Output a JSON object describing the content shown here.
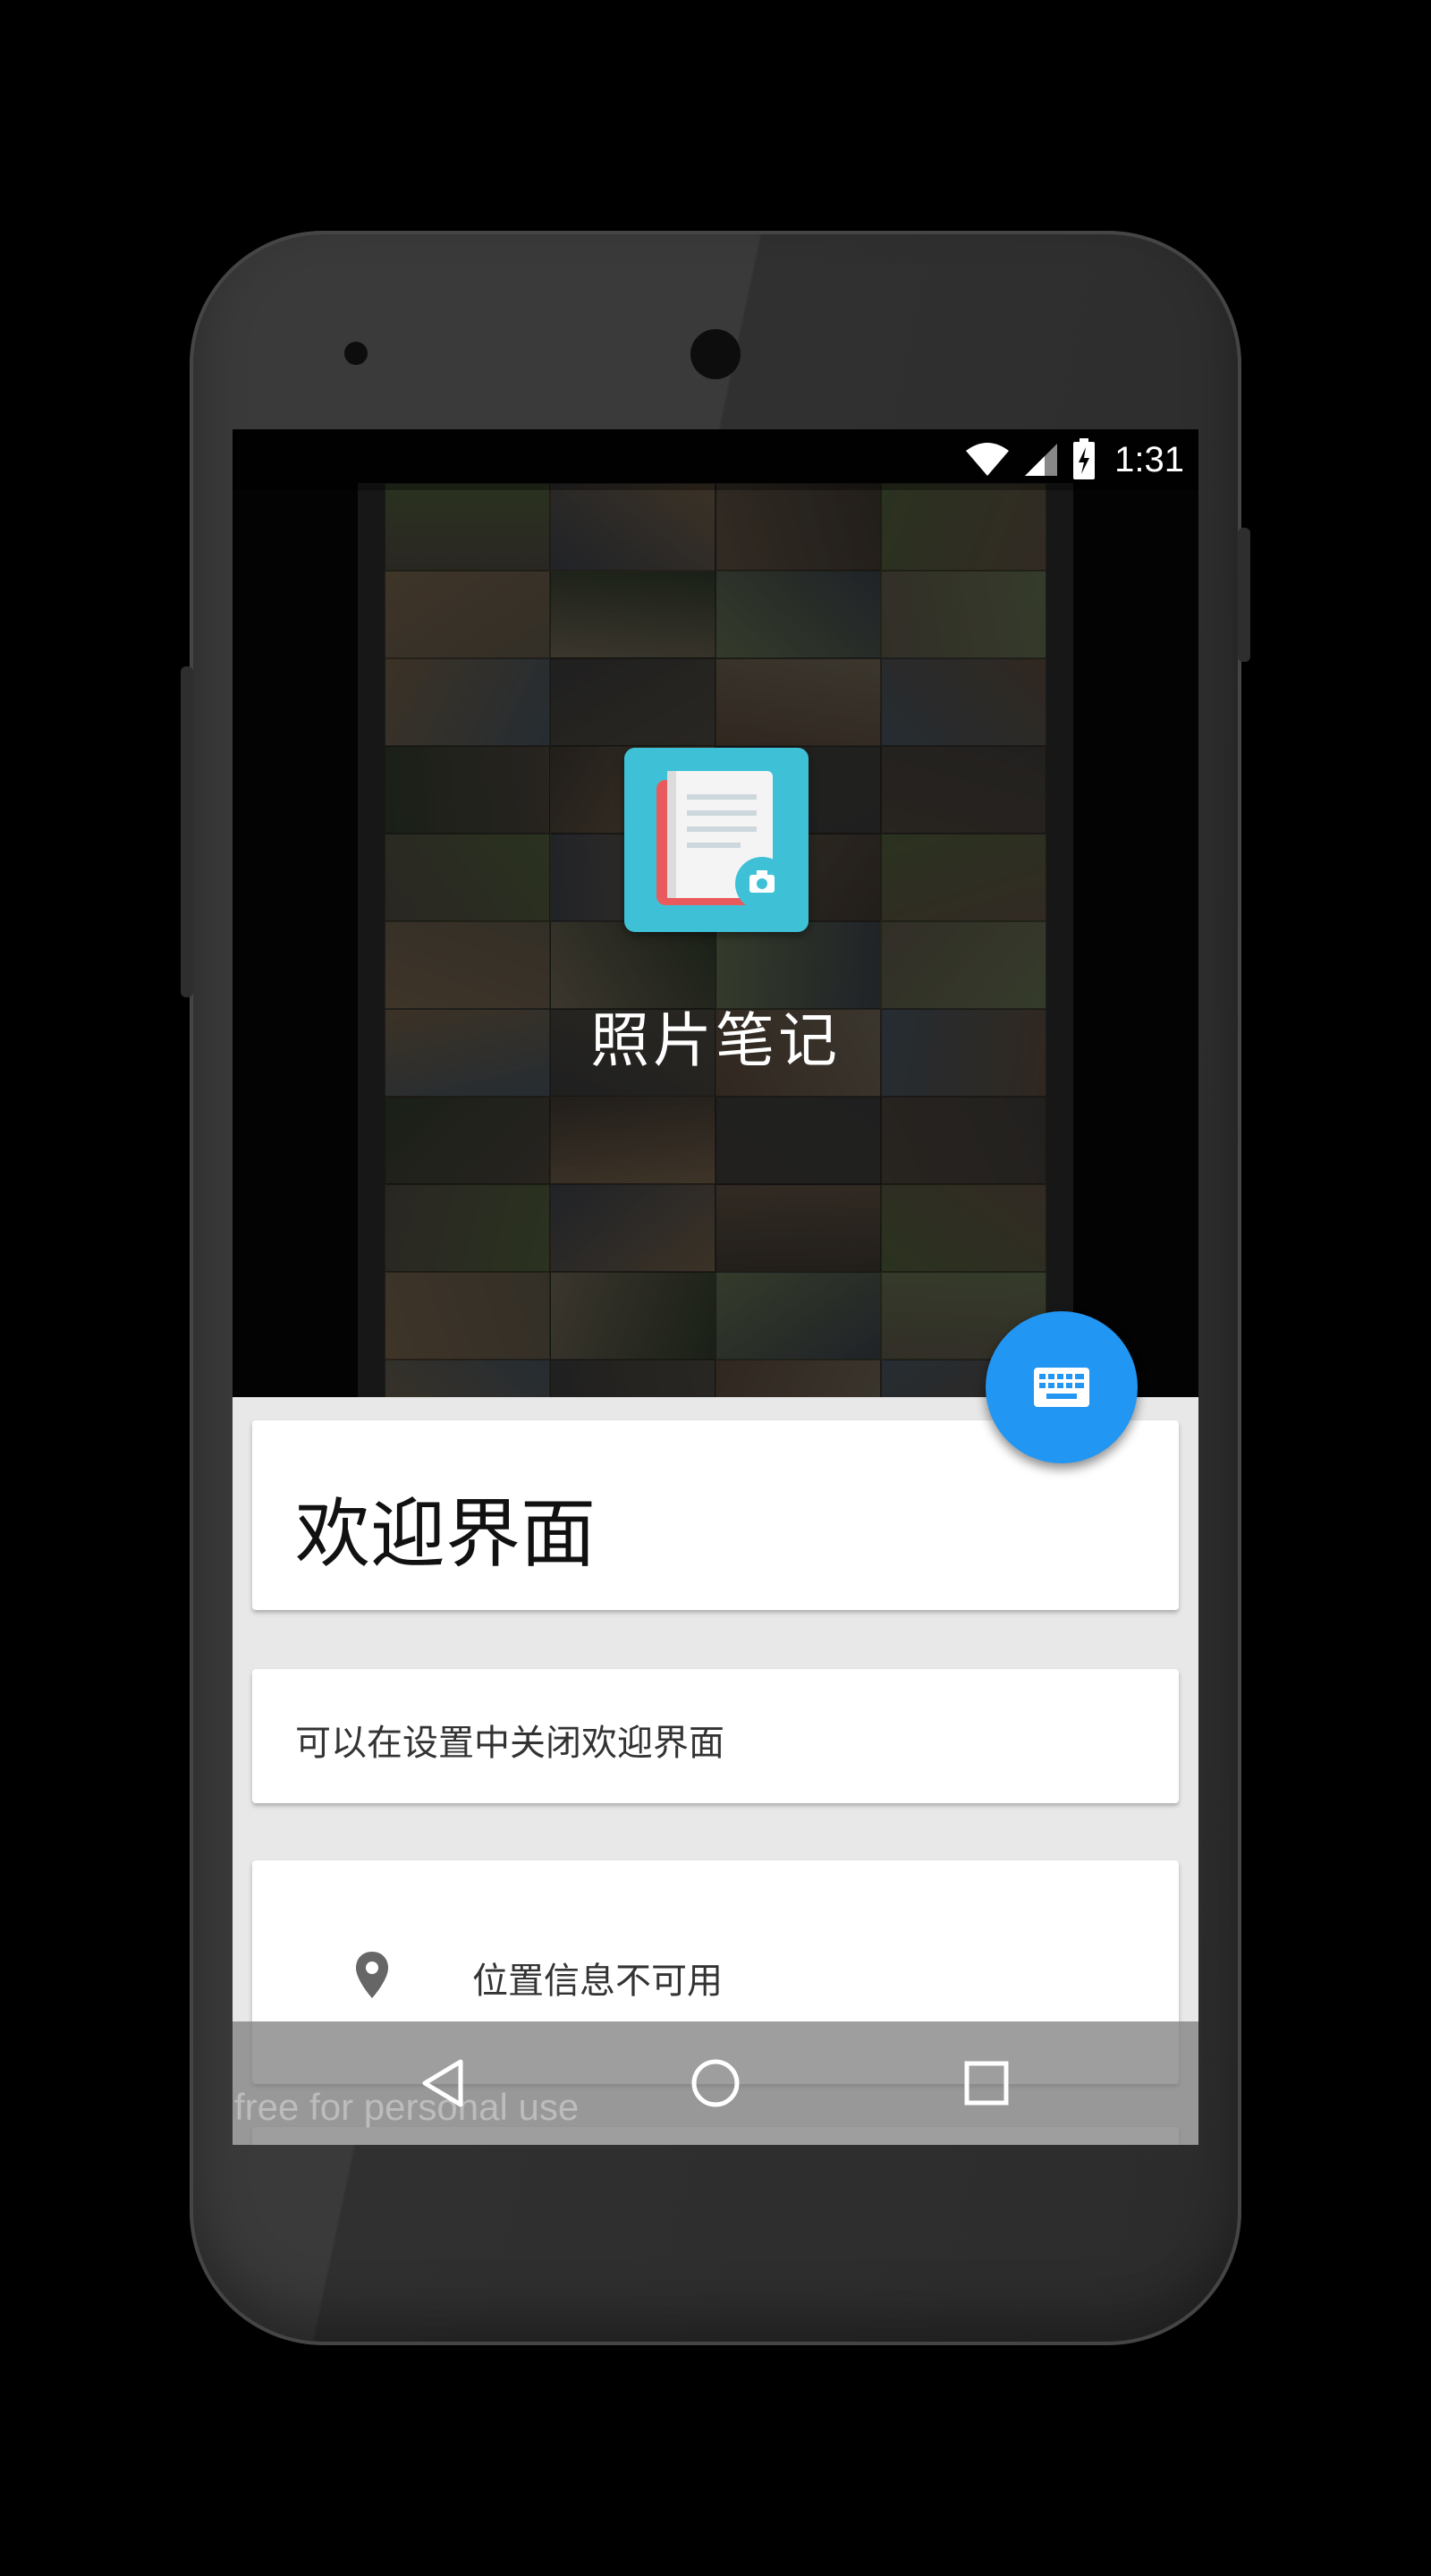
{
  "status_bar": {
    "time": "1:31",
    "icons": [
      "wifi-icon",
      "cellular-signal-icon",
      "battery-charging-icon"
    ]
  },
  "splash": {
    "app_icon": "photo-note-app-icon",
    "app_name": "照片笔记"
  },
  "fab": {
    "icon": "keyboard-icon",
    "color": "#2196f3"
  },
  "cards": {
    "title": "欢迎界面",
    "hint": "可以在设置中关闭欢迎界面",
    "location_icon": "location-pin-icon",
    "location_text": "位置信息不可用"
  },
  "nav_bar": {
    "buttons": [
      "back-icon",
      "home-icon",
      "recents-icon"
    ]
  },
  "watermark": "free for personal use",
  "colors": {
    "accent": "#2196f3",
    "app_icon_bg": "#3ec1d6",
    "notebook_red": "#e95a5e"
  }
}
